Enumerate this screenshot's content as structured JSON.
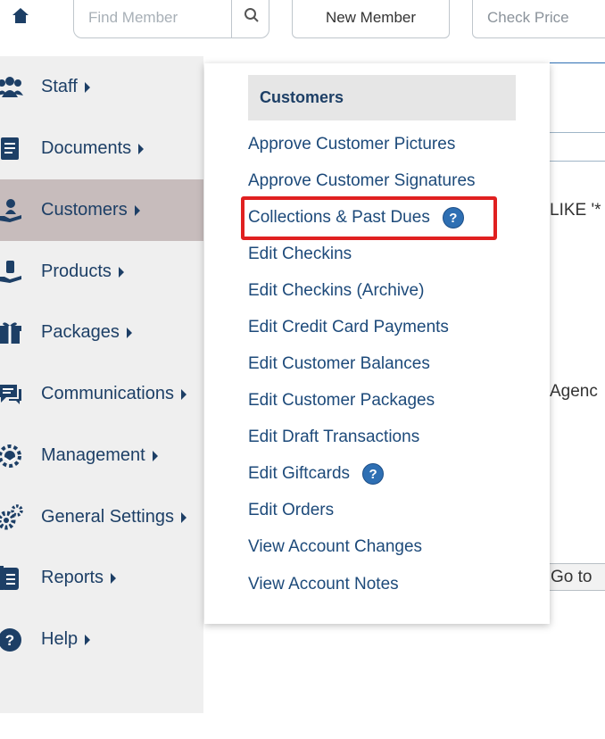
{
  "topbar": {
    "search_placeholder": "Find Member",
    "new_member_label": "New Member",
    "check_price_label": "Check Price"
  },
  "background": {
    "like_text": "LIKE '*",
    "agenc_text": "Agenc",
    "goto_label": "Go to"
  },
  "sidebar": {
    "items": [
      {
        "label": "Staff",
        "icon": "staff-icon"
      },
      {
        "label": "Documents",
        "icon": "documents-icon"
      },
      {
        "label": "Customers",
        "icon": "customers-icon"
      },
      {
        "label": "Products",
        "icon": "products-icon"
      },
      {
        "label": "Packages",
        "icon": "packages-icon"
      },
      {
        "label": "Communications",
        "icon": "communications-icon"
      },
      {
        "label": "Management",
        "icon": "management-icon"
      },
      {
        "label": "General Settings",
        "icon": "settings-icon"
      },
      {
        "label": "Reports",
        "icon": "reports-icon"
      },
      {
        "label": "Help",
        "icon": "help-icon"
      }
    ]
  },
  "menu": {
    "header": "Customers",
    "items": [
      {
        "label": "Approve Customer Pictures"
      },
      {
        "label": "Approve Customer Signatures"
      },
      {
        "label": "Collections & Past Dues",
        "help": "?"
      },
      {
        "label": "Edit Checkins"
      },
      {
        "label": "Edit Checkins (Archive)"
      },
      {
        "label": "Edit Credit Card Payments"
      },
      {
        "label": "Edit Customer Balances"
      },
      {
        "label": "Edit Customer Packages"
      },
      {
        "label": "Edit Draft Transactions"
      },
      {
        "label": "Edit Giftcards",
        "help": "?"
      },
      {
        "label": "Edit Orders"
      },
      {
        "label": "View Account Changes"
      },
      {
        "label": "View Account Notes"
      }
    ]
  },
  "colors": {
    "nav_text": "#1d3f66",
    "active_bg": "#c7bcbc",
    "highlight": "#e02020",
    "help_badge": "#2e6fb3"
  }
}
